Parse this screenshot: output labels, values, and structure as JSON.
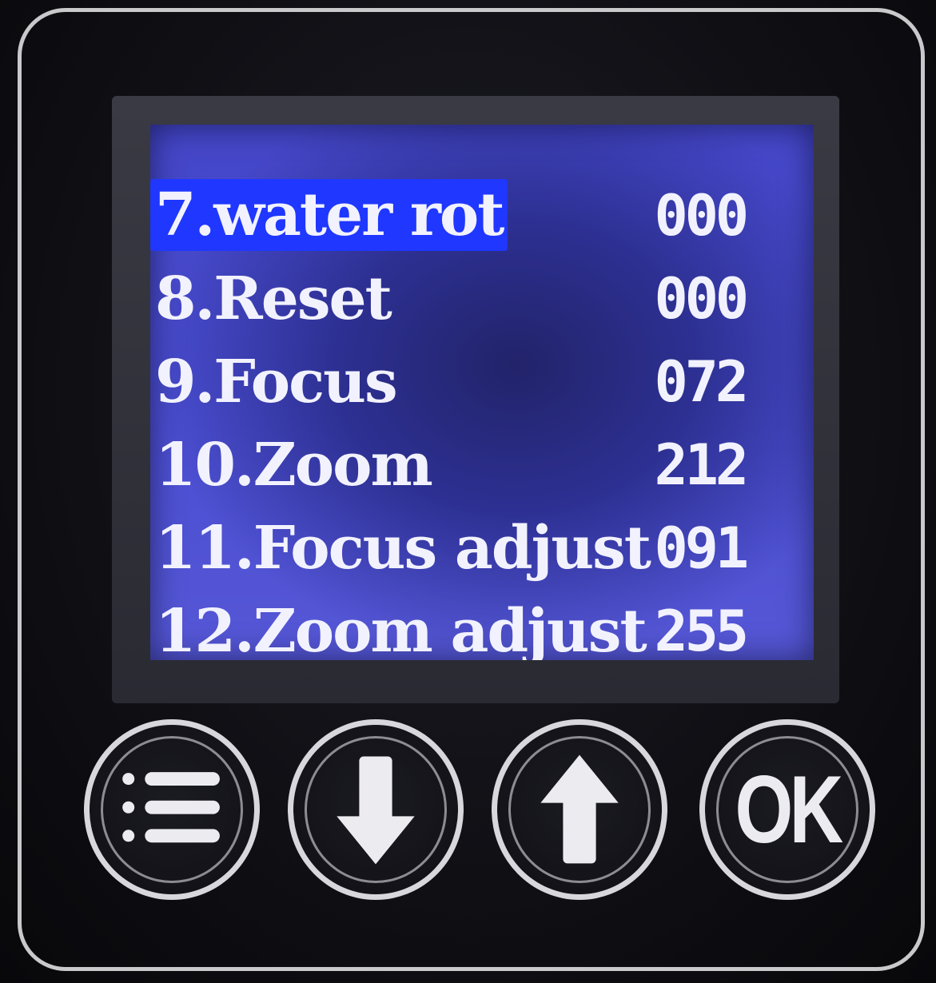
{
  "menu": {
    "items": [
      {
        "label": "7.water rot",
        "value": "000",
        "selected": true
      },
      {
        "label": "8.Reset",
        "value": "000",
        "selected": false
      },
      {
        "label": "9.Focus",
        "value": "072",
        "selected": false
      },
      {
        "label": "10.Zoom",
        "value": "212",
        "selected": false
      },
      {
        "label": "11.Focus adjust",
        "value": "091",
        "selected": false
      },
      {
        "label": "12.Zoom adjust",
        "value": "255",
        "selected": false
      }
    ]
  },
  "buttons": {
    "menu_icon": "list-menu-icon",
    "down_icon": "arrow-down-icon",
    "up_icon": "arrow-up-icon",
    "ok_label": "OK"
  },
  "colors": {
    "lcd_background": "#4446c8",
    "selection_highlight": "#1f37ff",
    "text": "#f2f2ff"
  }
}
